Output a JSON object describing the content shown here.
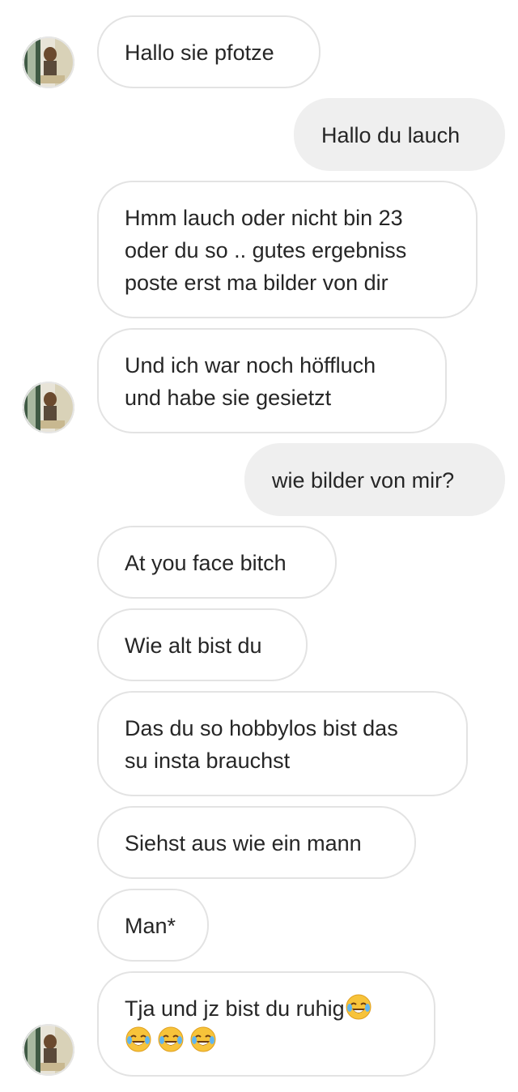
{
  "messages": [
    {
      "id": "m1",
      "sender": "contact",
      "lines": [
        "Hallo sie pfotze"
      ]
    },
    {
      "id": "m2",
      "sender": "me",
      "lines": [
        "Hallo du lauch"
      ]
    },
    {
      "id": "m3",
      "sender": "contact",
      "lines": [
        "Hmm lauch oder nicht bin 23",
        "oder du so .. gutes ergebniss",
        "poste erst ma bilder von dir"
      ]
    },
    {
      "id": "m4",
      "sender": "contact",
      "lines": [
        "Und ich war noch höffluch",
        "und habe sie gesietzt"
      ]
    },
    {
      "id": "m5",
      "sender": "me",
      "lines": [
        "wie bilder von mir?"
      ]
    },
    {
      "id": "m6",
      "sender": "contact",
      "lines": [
        "At you face bitch"
      ]
    },
    {
      "id": "m7",
      "sender": "contact",
      "lines": [
        "Wie alt bist du"
      ]
    },
    {
      "id": "m8",
      "sender": "contact",
      "lines": [
        "Das du so hobbylos bist das",
        "su insta brauchst"
      ]
    },
    {
      "id": "m9",
      "sender": "contact",
      "lines": [
        "Siehst aus wie ein mann"
      ]
    },
    {
      "id": "m10",
      "sender": "contact",
      "lines": [
        "Man*"
      ]
    },
    {
      "id": "m11",
      "sender": "contact",
      "lines": [
        "Tja und jz bist du ruhig"
      ],
      "emoji": "face-with-tears-of-joy",
      "emoji_line2_count": 3
    }
  ],
  "avatar_icon": "contact-avatar-photo",
  "colors": {
    "incoming_bubble_bg": "#ffffff",
    "incoming_bubble_border": "#e3e3e3",
    "outgoing_bubble_bg": "#efefef",
    "text": "#262626"
  }
}
